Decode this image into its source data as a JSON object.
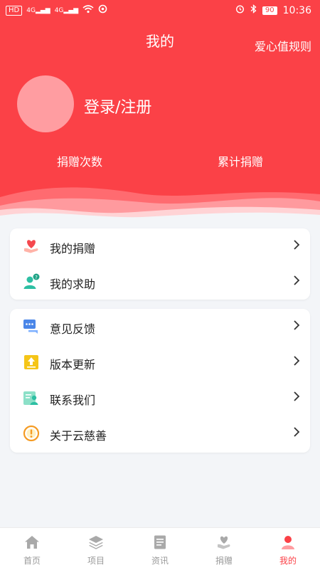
{
  "status_bar": {
    "network_badge": "HD",
    "signal1": "4G",
    "signal2": "4G",
    "battery": "90",
    "time": "10:36"
  },
  "header": {
    "title": "我的",
    "rules_link": "爱心值规则",
    "login_label": "登录/注册",
    "stats": {
      "donation_count_label": "捐赠次数",
      "total_donation_label": "累计捐赠"
    }
  },
  "menu_group1": [
    {
      "label": "我的捐赠",
      "icon": "heart-hand-icon"
    },
    {
      "label": "我的求助",
      "icon": "user-question-icon"
    }
  ],
  "menu_group2": [
    {
      "label": "意见反馈",
      "icon": "chat-bubble-icon"
    },
    {
      "label": "版本更新",
      "icon": "upload-icon"
    },
    {
      "label": "联系我们",
      "icon": "contact-card-icon"
    },
    {
      "label": "关于云慈善",
      "icon": "info-icon"
    }
  ],
  "tabbar": [
    {
      "label": "首页",
      "icon": "home-icon"
    },
    {
      "label": "项目",
      "icon": "layers-icon"
    },
    {
      "label": "资讯",
      "icon": "document-icon"
    },
    {
      "label": "捐赠",
      "icon": "heart-hand-icon"
    },
    {
      "label": "我的",
      "icon": "person-icon",
      "active": true
    }
  ],
  "colors": {
    "accent": "#fb4147",
    "avatar": "#ff9da1",
    "background": "#f3f5f8"
  }
}
